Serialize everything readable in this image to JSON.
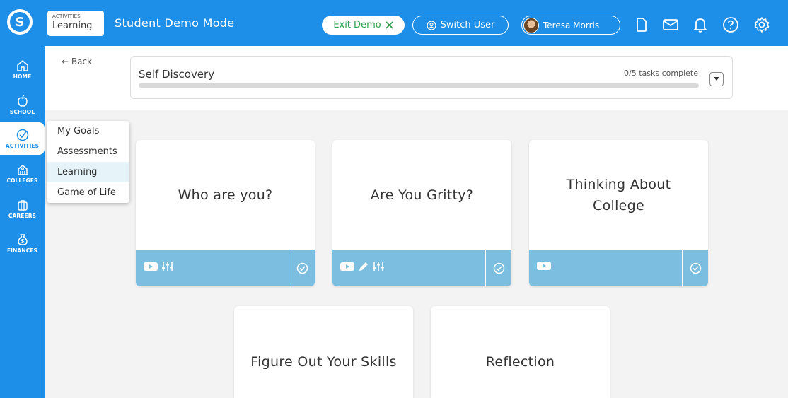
{
  "header": {
    "section_small": "ACTIVITIES",
    "section_big": "Learning",
    "mode_title": "Student Demo Mode",
    "exit_demo": "Exit Demo",
    "switch_user": "Switch User",
    "user_name": "Teresa Morris",
    "icons": [
      "document-icon",
      "mail-icon",
      "bell-icon",
      "help-icon",
      "gear-icon"
    ]
  },
  "sidebar": {
    "items": [
      {
        "label": "HOME",
        "icon": "home-icon"
      },
      {
        "label": "SCHOOL",
        "icon": "apple-icon"
      },
      {
        "label": "ACTIVITIES",
        "icon": "check-circle-icon",
        "active": true
      },
      {
        "label": "COLLEGES",
        "icon": "building-icon"
      },
      {
        "label": "CAREERS",
        "icon": "briefcase-icon"
      },
      {
        "label": "FINANCES",
        "icon": "money-bag-icon"
      }
    ]
  },
  "submenu": {
    "items": [
      "My Goals",
      "Assessments",
      "Learning",
      "Game of Life"
    ],
    "active": "Learning"
  },
  "back": "← Back",
  "progress": {
    "title": "Self Discovery",
    "status": "0/5 tasks complete",
    "fraction": 0
  },
  "cards": [
    {
      "title": "Who are you?",
      "icons": [
        "video-icon",
        "sliders-icon"
      ]
    },
    {
      "title": "Are You Gritty?",
      "icons": [
        "video-icon",
        "pencil-icon",
        "sliders-icon"
      ]
    },
    {
      "title": "Thinking About College",
      "icons": [
        "video-icon"
      ]
    },
    {
      "title": "Figure Out Your Skills",
      "icons": []
    },
    {
      "title": "Reflection",
      "icons": []
    }
  ],
  "colors": {
    "brand_blue": "#1e8fe8",
    "card_footer": "#7bbedf",
    "exit_green": "#2aa04a",
    "menu_active": "#e6f3f9"
  }
}
